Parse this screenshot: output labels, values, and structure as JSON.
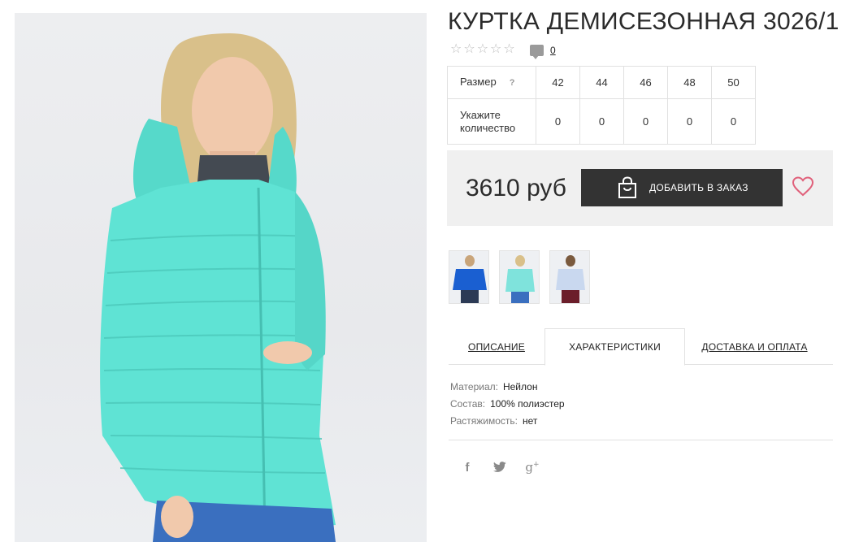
{
  "product": {
    "title": "КУРТКА ДЕМИСЕЗОННАЯ 3026/1",
    "rating_stars": 5,
    "comments_count": "0"
  },
  "sizes": {
    "size_label": "Размер",
    "help": "?",
    "qty_label": "Укажите количество",
    "list": [
      "42",
      "44",
      "46",
      "48",
      "50"
    ],
    "quantities": [
      "0",
      "0",
      "0",
      "0",
      "0"
    ]
  },
  "purchase": {
    "price": "3610 руб",
    "order_button": "ДОБАВИТЬ В ЗАКАЗ"
  },
  "thumbnails": [
    {
      "color": "#1a5fd1"
    },
    {
      "color": "#7fe3dc"
    },
    {
      "color": "#c9d8ef"
    }
  ],
  "tabs": [
    {
      "label": "ОПИСАНИЕ",
      "active": false
    },
    {
      "label": "ХАРАКТЕРИСТИКИ",
      "active": true
    },
    {
      "label": "ДОСТАВКА И ОПЛАТА",
      "active": false
    }
  ],
  "specs": [
    {
      "key": "Материал:",
      "value": "Нейлон"
    },
    {
      "key": "Состав:",
      "value": "100% полиэстер"
    },
    {
      "key": "Растяжимость:",
      "value": "нет"
    }
  ],
  "social": [
    {
      "icon": "facebook-icon",
      "glyph": "f"
    },
    {
      "icon": "twitter-icon",
      "glyph": "🐦"
    },
    {
      "icon": "google-plus-icon",
      "glyph": "g+"
    }
  ],
  "colors": {
    "jacket": "#5fe3d4",
    "button_bg": "#333333",
    "heart": "#e0607a",
    "price_box_bg": "#f0f0f0"
  }
}
